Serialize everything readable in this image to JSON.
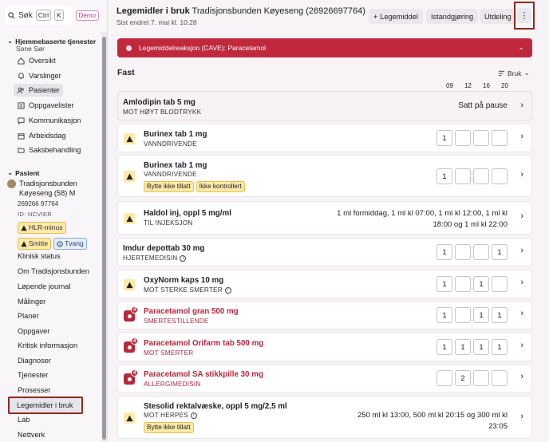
{
  "sidebar": {
    "search_label": "Søk",
    "kbd1": "Ctrl",
    "kbd2": "K",
    "demo": "Demo",
    "section1_title": "Hjemmebaserte tjenester",
    "section1_sub": "Sone Sør",
    "nav": [
      {
        "label": "Oversikt",
        "icon": "home-icon"
      },
      {
        "label": "Varslinger",
        "icon": "bell-icon"
      },
      {
        "label": "Pasienter",
        "icon": "people-icon"
      },
      {
        "label": "Oppgavelister",
        "icon": "list-icon"
      },
      {
        "label": "Kommunikasjon",
        "icon": "chat-icon"
      },
      {
        "label": "Arbeidsdag",
        "icon": "calendar-icon"
      },
      {
        "label": "Saksbehandling",
        "icon": "folder-icon"
      }
    ],
    "section2_title": "Pasient",
    "patient": {
      "name": "Tradisjonsbunden Køyeseng (58) M",
      "id": "269266 97764",
      "id2": "ID: NCVIER",
      "badge1": "HLR-minus",
      "badge2": "Smitte",
      "badge3": "Tvang"
    },
    "patient_nav": [
      "Klinisk status",
      "Om Tradisjonsbunden",
      "Løpende journal",
      "Målinger",
      "Planer",
      "Oppgaver",
      "Kritisk informasjon",
      "Diagnoser",
      "Tjenester",
      "Prosesser",
      "Legemidler i bruk",
      "Lab",
      "Nettverk"
    ]
  },
  "header": {
    "title_bold": "Legemidler i bruk",
    "title_rest": " Tradisjonsbunden Køyeseng (26926697764)",
    "sub": "Sist endret 7. mai kl. 10:28",
    "btn_add": "Legemiddel",
    "btn_istand": "Istandgjøring",
    "btn_utdeling": "Utdeling",
    "btn_more": "⋮"
  },
  "cave": "Legemiddelreaksjon (CAVE): Paracetamol",
  "section_fast": "Fast",
  "sort_label": "Bruk",
  "hours": [
    "09",
    "12",
    "16",
    "20"
  ],
  "meds": [
    {
      "name": "Amlodipin tab 5 mg",
      "sub": "MOT HØYT BLODTRYKK",
      "status": "Satt på pause"
    },
    {
      "name": "Burinex tab 1 mg",
      "sub": "VANNDRIVENDE",
      "doses": [
        "1",
        "",
        "",
        ""
      ]
    },
    {
      "name": "Burinex tab 1 mg",
      "sub": "VANNDRIVENDE",
      "tags": [
        "Bytte ikke tillatt",
        "Ikke kontrollert"
      ],
      "doses": [
        "1",
        "",
        "",
        ""
      ]
    },
    {
      "name": "Haldol inj, oppl 5 mg/ml",
      "sub": "TIL INJEKSJON",
      "text1": "1 ml formiddag, 1 ml kl 07:00, 1 ml kl 12:00, 1 ml kl",
      "text2": "18:00 og 1 ml kl 22:00"
    },
    {
      "name": "Imdur depottab 30 mg",
      "sub": "HJERTEMEDISIN",
      "doses": [
        "1",
        "",
        "",
        "1"
      ]
    },
    {
      "name": "OxyNorm kaps 10 mg",
      "sub": "MOT STERKE SMERTER",
      "doses": [
        "1",
        "",
        "1",
        ""
      ]
    },
    {
      "name": "Paracetamol gran 500 mg",
      "sub": "SMERTESTILLENDE",
      "count": "4",
      "doses": [
        "1",
        "",
        "1",
        "1"
      ]
    },
    {
      "name": "Paracetamol Orifarm tab 500 mg",
      "sub": "MOT SMERTER",
      "count": "4",
      "doses": [
        "1",
        "1",
        "1",
        "1"
      ]
    },
    {
      "name": "Paracetamol SA stikkpille 30 mg",
      "sub": "ALLERGIMEDISIN",
      "count": "4",
      "doses": [
        "",
        "2",
        "",
        ""
      ]
    },
    {
      "name": "Stesolid rektalvæske, oppl 5 mg/2,5 ml",
      "sub": "MOT HERPES",
      "tags": [
        "Bytte ikke tillatt"
      ],
      "text1": "250 ml kl 13:00, 500 ml kl 20:15 og 300 ml kl",
      "text2": "23:05"
    }
  ]
}
